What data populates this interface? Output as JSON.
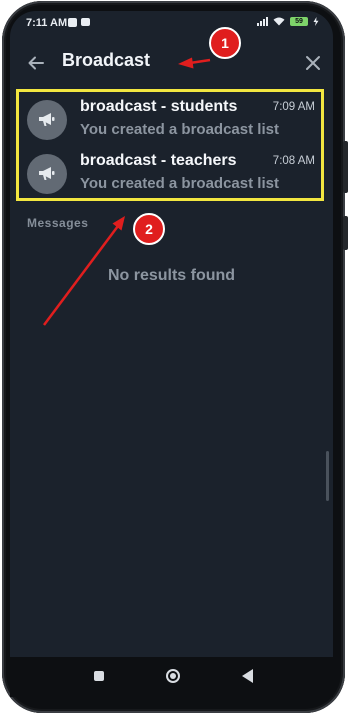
{
  "status_bar": {
    "time": "7:11 AM",
    "battery": "59"
  },
  "header": {
    "title": "Broadcast"
  },
  "results": [
    {
      "name": "broadcast - students",
      "time": "7:09 AM",
      "preview": "You created a broadcast list"
    },
    {
      "name": "broadcast - teachers",
      "time": "7:08 AM",
      "preview": "You created a broadcast list"
    }
  ],
  "messages_section": {
    "label": "Messages",
    "empty_text": "No results found"
  },
  "annotations": {
    "step1": "1",
    "step2": "2"
  },
  "colors": {
    "screen_bg": "#1b222c",
    "highlight_border": "#f2e640",
    "annotation_red": "#e01e1e"
  },
  "icons": [
    "back-arrow-icon",
    "close-icon",
    "megaphone-icon"
  ]
}
